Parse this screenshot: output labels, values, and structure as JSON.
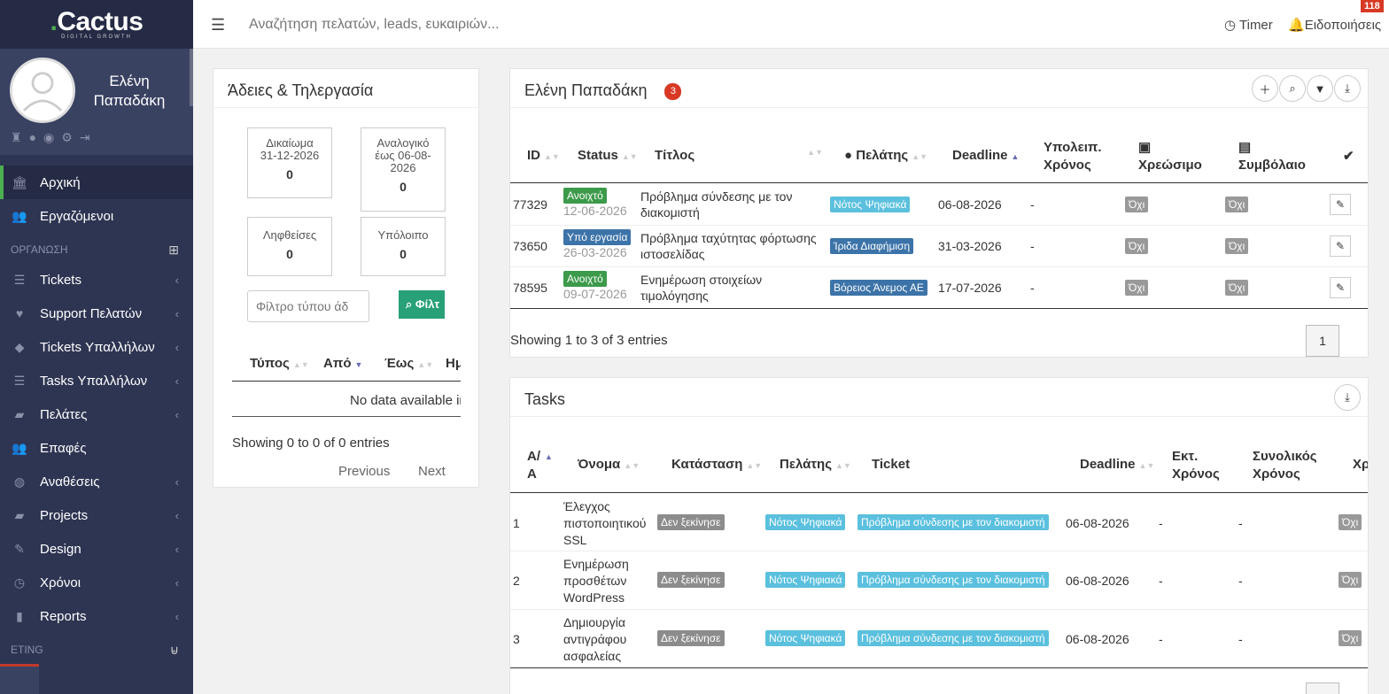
{
  "brand": {
    "name": "Cactus",
    "tagline": "DIGITAL GROWTH"
  },
  "user": {
    "name": "Ελένη Παπαδάκη"
  },
  "sidebar": {
    "items": [
      {
        "label": "Αρχική",
        "icon": "bank-icon",
        "chevron": false,
        "active": true
      },
      {
        "label": "Εργαζόμενοι",
        "icon": "users-icon",
        "chevron": false
      },
      {
        "header": "ΟΡΓΑΝΩΣΗ",
        "icon": "sitemap-icon"
      },
      {
        "label": "Tickets",
        "icon": "list-icon",
        "chevron": true
      },
      {
        "label": "Support Πελατών",
        "icon": "heartbeat-icon",
        "chevron": true
      },
      {
        "label": "Tickets Υπαλλήλων",
        "icon": "tag-icon",
        "chevron": true
      },
      {
        "label": "Tasks Υπαλλήλων",
        "icon": "list-icon",
        "chevron": true
      },
      {
        "label": "Πελάτες",
        "icon": "briefcase-icon",
        "chevron": true
      },
      {
        "label": "Επαφές",
        "icon": "users-icon",
        "chevron": false
      },
      {
        "label": "Αναθέσεις",
        "icon": "globe-icon",
        "chevron": true
      },
      {
        "label": "Projects",
        "icon": "briefcase-icon",
        "chevron": true
      },
      {
        "label": "Design",
        "icon": "brush-icon",
        "chevron": true
      },
      {
        "label": "Χρόνοι",
        "icon": "clock-icon",
        "chevron": true
      },
      {
        "label": "Reports",
        "icon": "chart-icon",
        "chevron": true
      },
      {
        "header": "ETING",
        "icon": "basket-icon"
      }
    ]
  },
  "topbar": {
    "search_placeholder": "Αναζήτηση πελατών, leads, ευκαιριών...",
    "timer": "Timer",
    "notifications": "Ειδοποιήσεις",
    "notif_count": "118"
  },
  "leave": {
    "title": "Άδειες & Τηλεργασία",
    "stats": [
      {
        "label": "Δικαίωμα 31-12-2026",
        "value": "0"
      },
      {
        "label": "Αναλογικό έως 06-08-2026",
        "value": "0"
      },
      {
        "label": "Ληφθείσες",
        "value": "0"
      },
      {
        "label": "Υπόλοιπο",
        "value": "0"
      }
    ],
    "filter_placeholder": "Φίλτρο τύπου άδ",
    "filter_btn": "Φίλτ",
    "columns": [
      "Τύπος",
      "Από",
      "Έως",
      "Ημ"
    ],
    "empty": "No data available in",
    "info": "Showing 0 to 0 of 0 entries",
    "prev": "Previous",
    "next": "Next"
  },
  "tickets": {
    "title": "Ελένη Παπαδάκη",
    "count": "3",
    "columns": {
      "id": "ID",
      "status": "Status",
      "title": "Τίτλος",
      "client": "Πελάτης",
      "deadline": "Deadline",
      "remaining": "Υπολειπ. Χρόνος",
      "billable": "Χρεώσιμο",
      "contract": "Συμβόλαιο"
    },
    "rows": [
      {
        "id": "77329",
        "status": "Ανοιχτό",
        "status_color": "#3c9a4a",
        "date": "12-06-2026",
        "title": "Πρόβλημα σύνδεσης με τον διακομιστή",
        "client": "Νότος Ψηφιακά",
        "client_color": "#5bc0de",
        "deadline": "06-08-2026",
        "remaining": "-",
        "billable": "Όχι",
        "contract": "Όχι"
      },
      {
        "id": "73650",
        "status": "Υπό εργασία",
        "status_color": "#3c73a8",
        "date": "26-03-2026",
        "title": "Πρόβλημα ταχύτητας φόρτωσης ιστοσελίδας",
        "client": "Ίριδα Διαφήμιση",
        "client_color": "#3c73a8",
        "deadline": "31-03-2026",
        "remaining": "-",
        "billable": "Όχι",
        "contract": "Όχι"
      },
      {
        "id": "78595",
        "status": "Ανοιχτό",
        "status_color": "#3c9a4a",
        "date": "09-07-2026",
        "title": "Ενημέρωση στοιχείων τιμολόγησης",
        "client": "Βόρειος Άνεμος ΑΕ",
        "client_color": "#3c73a8",
        "deadline": "17-07-2026",
        "remaining": "-",
        "billable": "Όχι",
        "contract": "Όχι"
      }
    ],
    "info": "Showing 1 to 3 of 3 entries",
    "page": "1"
  },
  "tasks": {
    "title": "Tasks",
    "columns": {
      "aa": "Α/Α",
      "name": "Όνομα",
      "state": "Κατάσταση",
      "client": "Πελάτης",
      "ticket": "Ticket",
      "deadline": "Deadline",
      "est": "Εκτ. Χρόνος",
      "total": "Συνολικός Χρόνος",
      "xr": "Χρ"
    },
    "rows": [
      {
        "aa": "1",
        "name": "Έλεγχος πιστοποιητικού SSL",
        "state": "Δεν ξεκίνησε",
        "client": "Νότος Ψηφιακά",
        "ticket": "Πρόβλημα σύνδεσης με τον διακομιστή",
        "deadline": "06-08-2026",
        "est": "-",
        "total": "-",
        "xr": "Όχι"
      },
      {
        "aa": "2",
        "name": "Ενημέρωση προσθέτων WordPress",
        "state": "Δεν ξεκίνησε",
        "client": "Νότος Ψηφιακά",
        "ticket": "Πρόβλημα σύνδεσης με τον διακομιστή",
        "deadline": "06-08-2026",
        "est": "-",
        "total": "-",
        "xr": "Όχι"
      },
      {
        "aa": "3",
        "name": "Δημιουργία αντιγράφου ασφαλείας",
        "state": "Δεν ξεκίνησε",
        "client": "Νότος Ψηφιακά",
        "ticket": "Πρόβλημα σύνδεσης με τον διακομιστή",
        "deadline": "06-08-2026",
        "est": "-",
        "total": "-",
        "xr": "Όχι"
      }
    ]
  }
}
